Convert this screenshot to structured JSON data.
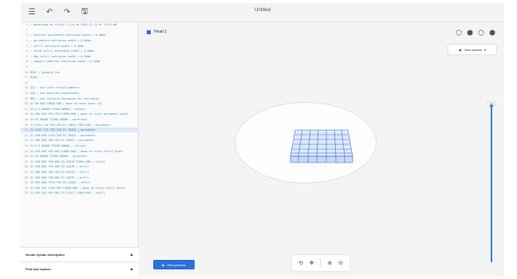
{
  "window": {
    "title": "Untitled",
    "menu_icon": "☰",
    "undo_icon": "↶",
    "redo_icon": "↷",
    "save_icon": "🖫"
  },
  "code_lines": [
    {
      "n": "1",
      "t": "; generated by Slic3r 1.3.0 on 2020-12-13 at 14:32:08"
    },
    {
      "n": "2",
      "t": ""
    },
    {
      "n": "3",
      "t": "; external perimeters extrusion width = 0.46mm"
    },
    {
      "n": "4",
      "t": "; perimeters extrusion width = 0.46mm"
    },
    {
      "n": "5",
      "t": "; infill extrusion width = 0.46mm"
    },
    {
      "n": "6",
      "t": "; solid infill extrusion width = 0.46mm"
    },
    {
      "n": "7",
      "t": "; top infill extrusion width = 0.46mm"
    },
    {
      "n": "8",
      "t": "; support material extrusion width = 0.46mm"
    },
    {
      "n": "9",
      "t": ""
    },
    {
      "n": "10",
      "t": "M107 ; disable fan"
    },
    {
      "n": "11",
      "t": "M104"
    },
    {
      "n": "12",
      "t": ""
    },
    {
      "n": "13",
      "t": "G21 ; set units to millimeters"
    },
    {
      "n": "14",
      "t": "G90 ; use absolute coordinates"
    },
    {
      "n": "15",
      "t": "M83 ; use relative distances for extrusion"
    },
    {
      "n": "16",
      "t": "G1 Z0.600 F3600.000 ; move to next layer (0)"
    },
    {
      "n": "17",
      "t": "G1 E-5.00000 F2400.00000 ; retract"
    },
    {
      "n": "18",
      "t": "G1 X96.849 Y96.320 F4800.000 ; move to first perimeter point"
    },
    {
      "n": "19",
      "t": "G1 E5.00000 F2400.00000 ; unretract"
    },
    {
      "n": "20",
      "t": "G1 X152.714 Y95.320 E1.70045 F900.000 ; perimeter"
    },
    {
      "n": "21",
      "t": "G1 X152.714 Y95.320 E1.70459 ; perimeter"
    },
    {
      "n": "22",
      "t": "G1 X96.849 Y153.159 E1.70441 ; perimeter"
    },
    {
      "n": "23",
      "t": "G1 X96.849 Y96.320 E1.70441 ; perimeter"
    },
    {
      "n": "24",
      "t": "G1 E-5.00000 F2400.00000 ; retract"
    },
    {
      "n": "25",
      "t": "G1 X93.609 Y93.603 F4800.000 ; move to first infill point"
    },
    {
      "n": "26",
      "t": "G1 E5.00000 F2400.00000 ; unretract"
    },
    {
      "n": "27",
      "t": "G1 X98.805 Y98.809 E2.44578 F1500.000 ; infill"
    },
    {
      "n": "28",
      "t": "G1 X98.805 Y95.809 E2.44578 ; infill"
    },
    {
      "n": "29",
      "t": "G1 X98.805 Y96.320 E2.44578 ; infill"
    },
    {
      "n": "30",
      "t": "G1 X98.805 Y98.809 E2.44578 ; infill"
    },
    {
      "n": "31",
      "t": "G1 X69.800 Y150.763 E2.12582 ; infill"
    },
    {
      "n": "32",
      "t": "G1 X95.320 Y150.903 F4800.000 ; move to first infill point"
    },
    {
      "n": "33",
      "t": "G1 X95.320 Y95.561 E2.11417 F1500.000 ; infill"
    }
  ],
  "highlighted_line": 21,
  "panels": {
    "gcode_syntax": "Gcode syntax description",
    "find_replace": "Find and replace",
    "chevron": "▲"
  },
  "viewer": {
    "head_label": "Head 1",
    "view_options": "View options",
    "slider_value": "0.0",
    "print_preview": "Print preview"
  }
}
